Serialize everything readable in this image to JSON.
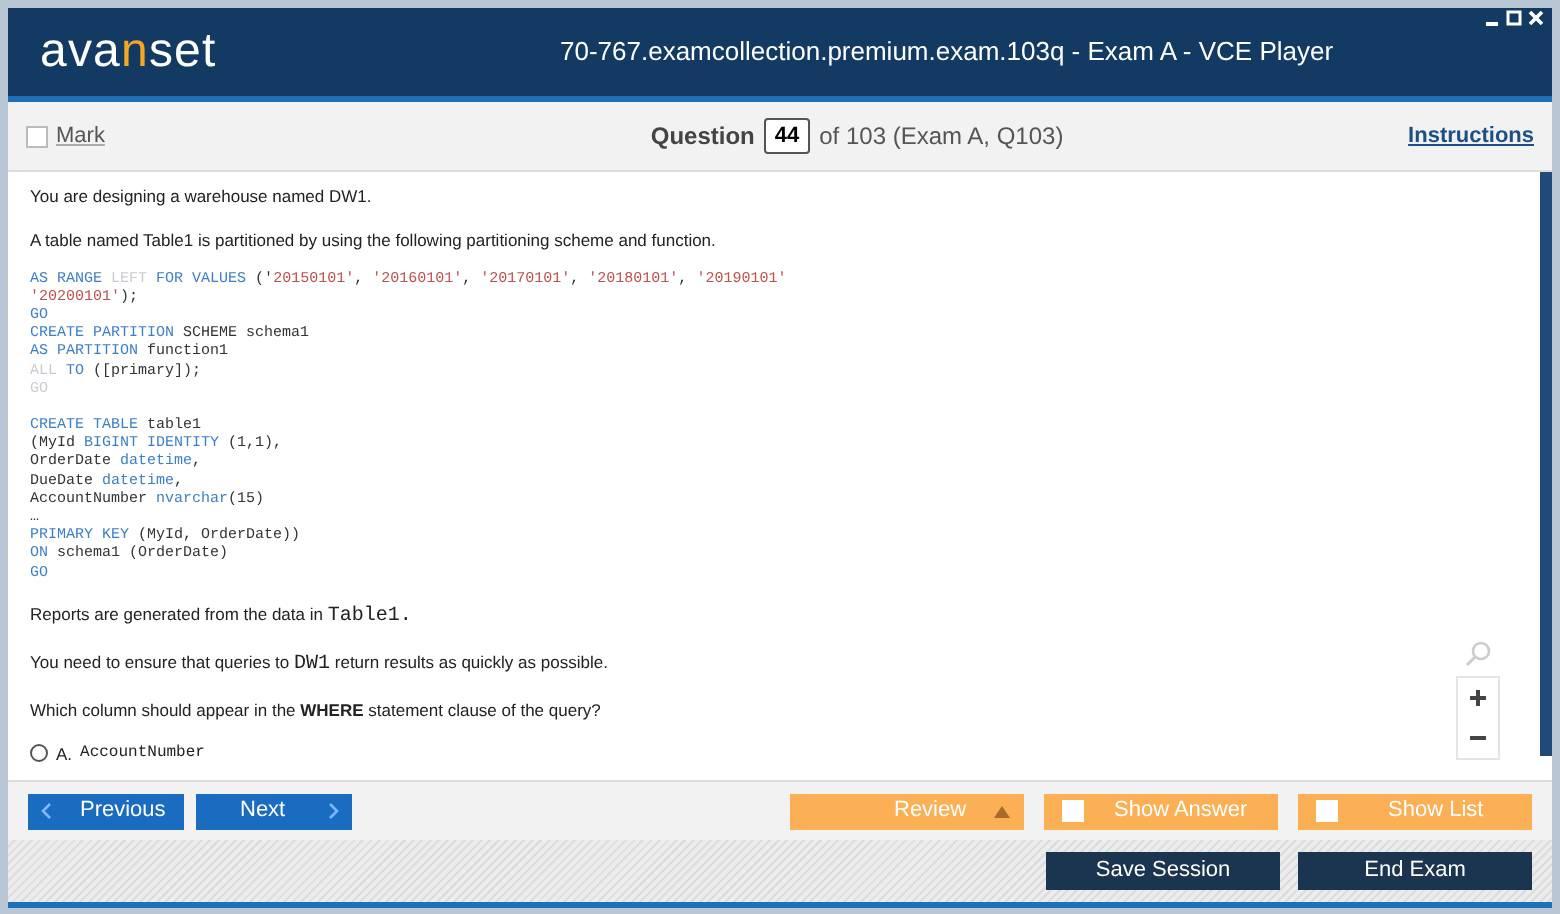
{
  "header": {
    "logo_left": "ava",
    "logo_mid": "n",
    "logo_right": "set",
    "title": "70-767.examcollection.premium.exam.103q - Exam A - VCE Player"
  },
  "toolbar": {
    "mark": {
      "label": "Mark",
      "checked": false
    },
    "question_label": "Question",
    "question_number": "44",
    "of_text": "of 103 (Exam A, Q103)",
    "instructions": "Instructions"
  },
  "question": {
    "intro": [
      "You are designing a warehouse named DW1.",
      "A table named Table1 is partitioned by using the following partitioning scheme and function."
    ],
    "code_blocks": [
      [
        [
          {
            "kind": "kw",
            "text": "AS RANGE "
          },
          {
            "kind": "dim",
            "text": "LEFT "
          },
          {
            "kind": "kw",
            "text": "FOR VALUES "
          },
          {
            "kind": "plain",
            "text": "('"
          },
          {
            "kind": "str",
            "text": "20150101'"
          },
          {
            "kind": "plain",
            "text": ", "
          },
          {
            "kind": "str",
            "text": "'20160101'"
          },
          {
            "kind": "plain",
            "text": ", "
          },
          {
            "kind": "str",
            "text": "'20170101'"
          },
          {
            "kind": "plain",
            "text": ", "
          },
          {
            "kind": "str",
            "text": "'20180101'"
          },
          {
            "kind": "plain",
            "text": ", "
          },
          {
            "kind": "str",
            "text": "'20190101'"
          }
        ],
        [
          {
            "kind": "str",
            "text": "'20200101'"
          },
          {
            "kind": "plain",
            "text": ");"
          }
        ],
        [
          {
            "kind": "kw",
            "text": "GO"
          }
        ],
        [
          {
            "kind": "kw",
            "text": "CREATE PARTITION "
          },
          {
            "kind": "plain",
            "text": "SCHEME schema1"
          }
        ],
        [
          {
            "kind": "kw",
            "text": "AS PARTITION "
          },
          {
            "kind": "plain",
            "text": "function1"
          }
        ],
        [
          {
            "kind": "dim",
            "text": "ALL "
          },
          {
            "kind": "kw",
            "text": "TO "
          },
          {
            "kind": "plain",
            "text": "([primary]);"
          }
        ],
        [
          {
            "kind": "dim",
            "text": "GO"
          }
        ]
      ],
      [
        [
          {
            "kind": "kw",
            "text": "CREATE TABLE "
          },
          {
            "kind": "plain",
            "text": "table1"
          }
        ],
        [
          {
            "kind": "plain",
            "text": "(MyId "
          },
          {
            "kind": "kw",
            "text": "BIGINT IDENTITY "
          },
          {
            "kind": "plain",
            "text": "(1,1),"
          }
        ],
        [
          {
            "kind": "plain",
            "text": "OrderDate "
          },
          {
            "kind": "kw",
            "text": "datetime"
          },
          {
            "kind": "plain",
            "text": ","
          }
        ],
        [
          {
            "kind": "plain",
            "text": "DueDate "
          },
          {
            "kind": "kw",
            "text": "datetime"
          },
          {
            "kind": "plain",
            "text": ","
          }
        ],
        [
          {
            "kind": "plain",
            "text": "AccountNumber "
          },
          {
            "kind": "kw",
            "text": "nvarchar"
          },
          {
            "kind": "plain",
            "text": "(15)"
          }
        ],
        [
          {
            "kind": "plain",
            "text": "…"
          }
        ],
        [
          {
            "kind": "kw",
            "text": "PRIMARY KEY "
          },
          {
            "kind": "plain",
            "text": "(MyId, OrderDate))"
          }
        ],
        [
          {
            "kind": "kw",
            "text": "ON "
          },
          {
            "kind": "plain",
            "text": "schema1 (OrderDate)"
          }
        ],
        [
          {
            "kind": "kw",
            "text": "GO"
          }
        ]
      ]
    ],
    "paragraphs": [
      [
        {
          "kind": "text",
          "text": "Reports are generated from the data in "
        },
        {
          "kind": "code",
          "text": "Table1."
        }
      ],
      [
        {
          "kind": "text",
          "text": "You need to ensure that queries to "
        },
        {
          "kind": "code",
          "text": "DW1"
        },
        {
          "kind": "text",
          "text": "  return results as quickly as possible."
        }
      ],
      [
        {
          "kind": "text",
          "text": "Which column should appear in the "
        },
        {
          "kind": "bold",
          "text": "WHERE"
        },
        {
          "kind": "text",
          "text": " statement clause of the query?"
        }
      ]
    ],
    "options": [
      {
        "letter": "A.",
        "text": "AccountNumber",
        "selected": false
      }
    ]
  },
  "nav": {
    "previous": "Previous",
    "next": "Next",
    "review": "Review",
    "show_answer": {
      "label": "Show Answer",
      "checked": false
    },
    "show_list": {
      "label": "Show List",
      "checked": false
    }
  },
  "footer": {
    "save": "Save Session",
    "end": "End Exam"
  }
}
